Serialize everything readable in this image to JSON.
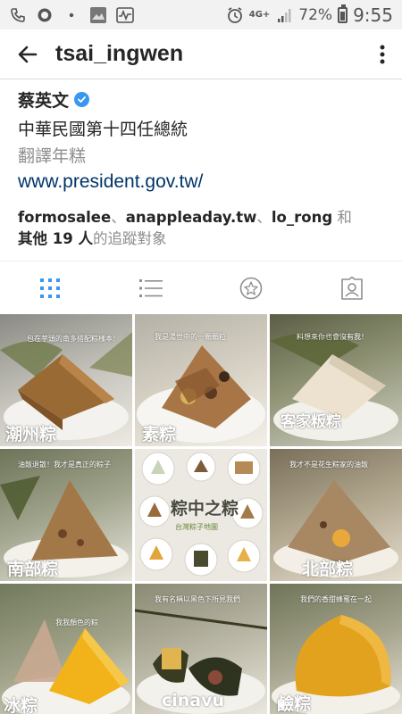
{
  "status_bar": {
    "network": "4G+",
    "battery": "72%",
    "time": "9:55"
  },
  "header": {
    "username": "tsai_ingwen"
  },
  "profile": {
    "name": "蔡英文",
    "bio_title": "中華民國第十四任總統",
    "bio_note": "翻譯年糕",
    "website": "www.president.gov.tw/",
    "followed_by": {
      "user1": "formosalee",
      "sep1": "、",
      "user2": "anappleaday.tw",
      "sep2": "、",
      "user3": "lo_rong",
      "and": "和",
      "others": "其他 19 人",
      "suffix": "的追蹤對象"
    }
  },
  "tabs": [
    {
      "name": "grid-view",
      "active": true
    },
    {
      "name": "list-view",
      "active": false
    },
    {
      "name": "map-view",
      "active": false
    },
    {
      "name": "tagged-view",
      "active": false
    }
  ],
  "posts": [
    {
      "caption": "潮州粽",
      "note": "包在芋頭的南多搭配粽樣本！"
    },
    {
      "caption": "素粽",
      "note": "我是湯世中的一顆顆粒"
    },
    {
      "caption": "客家粄粽",
      "note": "料想來你也會沒有我！"
    },
    {
      "caption": "南部粽",
      "note": "油飯退散！我才是真正的粽子"
    },
    {
      "caption": "粽中之粽",
      "note": "台灣粽子地圖"
    },
    {
      "caption": "北部粽",
      "note": "我才不是花生粽家的油飯"
    },
    {
      "caption": "冰粽",
      "note": "我我顏色的粽"
    },
    {
      "caption": "cinavu",
      "note": "我有名稱以黑色下所見我們"
    },
    {
      "caption": "鹼粽",
      "note": "我們的香甜蜂蜜在一起"
    }
  ],
  "colors": {
    "accent_blue": "#3897f0",
    "link": "#003569",
    "text": "#262626",
    "muted": "#8e8e8e"
  }
}
